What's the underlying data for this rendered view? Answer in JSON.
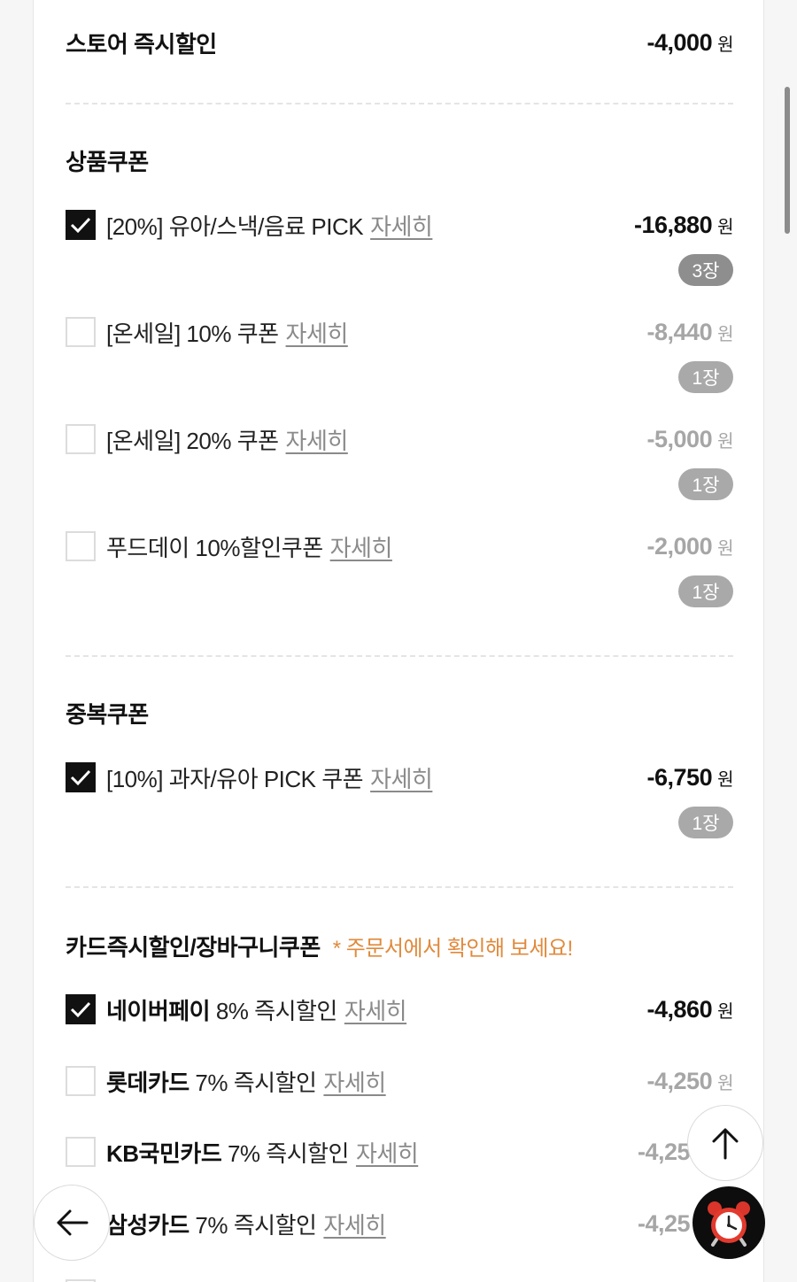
{
  "store_discount": {
    "title": "스토어 즉시할인",
    "amount": "-4,000",
    "currency": "원"
  },
  "product_coupons": {
    "title": "상품쿠폰",
    "items": [
      {
        "label": "[20%] 유아/스낵/음료 PICK",
        "detail": "자세히",
        "amount": "-16,880",
        "currency": "원",
        "count": "3장",
        "checked": true
      },
      {
        "label": "[온세일] 10% 쿠폰",
        "detail": "자세히",
        "amount": "-8,440",
        "currency": "원",
        "count": "1장",
        "checked": false
      },
      {
        "label": "[온세일] 20% 쿠폰",
        "detail": "자세히",
        "amount": "-5,000",
        "currency": "원",
        "count": "1장",
        "checked": false
      },
      {
        "label": "푸드데이 10%할인쿠폰",
        "detail": "자세히",
        "amount": "-2,000",
        "currency": "원",
        "count": "1장",
        "checked": false
      }
    ]
  },
  "stack_coupons": {
    "title": "중복쿠폰",
    "items": [
      {
        "label": "[10%] 과자/유아 PICK 쿠폰",
        "detail": "자세히",
        "amount": "-6,750",
        "currency": "원",
        "count": "1장",
        "checked": true
      }
    ]
  },
  "card_discounts": {
    "title": "카드즉시할인/장바구니쿠폰",
    "note": "* 주문서에서 확인해 보세요!",
    "items": [
      {
        "brand": "네이버페이",
        "label": "8% 즉시할인",
        "detail": "자세히",
        "amount": "-4,860",
        "currency": "원",
        "checked": true
      },
      {
        "brand": "롯데카드",
        "label": "7% 즉시할인",
        "detail": "자세히",
        "amount": "-4,250",
        "currency": "원",
        "checked": false
      },
      {
        "brand": "KB국민카드",
        "label": "7% 즉시할인",
        "detail": "자세히",
        "amount": "-4,25",
        "currency": "",
        "checked": false
      },
      {
        "brand": "삼성카드",
        "label": "7% 즉시할인",
        "detail": "자세히",
        "amount": "-4,25",
        "currency": "",
        "checked": false
      }
    ]
  },
  "colors": {
    "accent_note": "#e08a3c",
    "checked": "#111111",
    "badge": "#8e8e8e"
  },
  "icons": {
    "scroll_top": "arrow-up-icon",
    "back": "arrow-left-icon",
    "alarm": "alarm-clock-icon"
  }
}
